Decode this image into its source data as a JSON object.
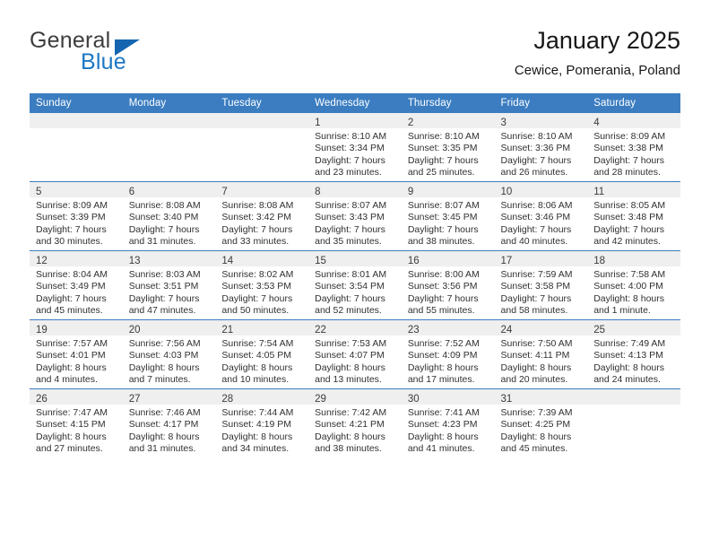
{
  "brand": {
    "name_part1": "General",
    "name_part2": "Blue",
    "triangle_icon": "triangle-icon",
    "accent_color": "#1565b0"
  },
  "header": {
    "title": "January 2025",
    "subtitle": "Cewice, Pomerania, Poland"
  },
  "theme": {
    "header_row_color": "#3b7dc0",
    "daynum_band_color": "#efefef",
    "text_color": "#303030"
  },
  "calendar": {
    "weekday_headers": [
      "Sunday",
      "Monday",
      "Tuesday",
      "Wednesday",
      "Thursday",
      "Friday",
      "Saturday"
    ],
    "weeks": [
      [
        {
          "day": "",
          "lines": []
        },
        {
          "day": "",
          "lines": []
        },
        {
          "day": "",
          "lines": []
        },
        {
          "day": "1",
          "lines": [
            "Sunrise: 8:10 AM",
            "Sunset: 3:34 PM",
            "Daylight: 7 hours",
            "and 23 minutes."
          ]
        },
        {
          "day": "2",
          "lines": [
            "Sunrise: 8:10 AM",
            "Sunset: 3:35 PM",
            "Daylight: 7 hours",
            "and 25 minutes."
          ]
        },
        {
          "day": "3",
          "lines": [
            "Sunrise: 8:10 AM",
            "Sunset: 3:36 PM",
            "Daylight: 7 hours",
            "and 26 minutes."
          ]
        },
        {
          "day": "4",
          "lines": [
            "Sunrise: 8:09 AM",
            "Sunset: 3:38 PM",
            "Daylight: 7 hours",
            "and 28 minutes."
          ]
        }
      ],
      [
        {
          "day": "5",
          "lines": [
            "Sunrise: 8:09 AM",
            "Sunset: 3:39 PM",
            "Daylight: 7 hours",
            "and 30 minutes."
          ]
        },
        {
          "day": "6",
          "lines": [
            "Sunrise: 8:08 AM",
            "Sunset: 3:40 PM",
            "Daylight: 7 hours",
            "and 31 minutes."
          ]
        },
        {
          "day": "7",
          "lines": [
            "Sunrise: 8:08 AM",
            "Sunset: 3:42 PM",
            "Daylight: 7 hours",
            "and 33 minutes."
          ]
        },
        {
          "day": "8",
          "lines": [
            "Sunrise: 8:07 AM",
            "Sunset: 3:43 PM",
            "Daylight: 7 hours",
            "and 35 minutes."
          ]
        },
        {
          "day": "9",
          "lines": [
            "Sunrise: 8:07 AM",
            "Sunset: 3:45 PM",
            "Daylight: 7 hours",
            "and 38 minutes."
          ]
        },
        {
          "day": "10",
          "lines": [
            "Sunrise: 8:06 AM",
            "Sunset: 3:46 PM",
            "Daylight: 7 hours",
            "and 40 minutes."
          ]
        },
        {
          "day": "11",
          "lines": [
            "Sunrise: 8:05 AM",
            "Sunset: 3:48 PM",
            "Daylight: 7 hours",
            "and 42 minutes."
          ]
        }
      ],
      [
        {
          "day": "12",
          "lines": [
            "Sunrise: 8:04 AM",
            "Sunset: 3:49 PM",
            "Daylight: 7 hours",
            "and 45 minutes."
          ]
        },
        {
          "day": "13",
          "lines": [
            "Sunrise: 8:03 AM",
            "Sunset: 3:51 PM",
            "Daylight: 7 hours",
            "and 47 minutes."
          ]
        },
        {
          "day": "14",
          "lines": [
            "Sunrise: 8:02 AM",
            "Sunset: 3:53 PM",
            "Daylight: 7 hours",
            "and 50 minutes."
          ]
        },
        {
          "day": "15",
          "lines": [
            "Sunrise: 8:01 AM",
            "Sunset: 3:54 PM",
            "Daylight: 7 hours",
            "and 52 minutes."
          ]
        },
        {
          "day": "16",
          "lines": [
            "Sunrise: 8:00 AM",
            "Sunset: 3:56 PM",
            "Daylight: 7 hours",
            "and 55 minutes."
          ]
        },
        {
          "day": "17",
          "lines": [
            "Sunrise: 7:59 AM",
            "Sunset: 3:58 PM",
            "Daylight: 7 hours",
            "and 58 minutes."
          ]
        },
        {
          "day": "18",
          "lines": [
            "Sunrise: 7:58 AM",
            "Sunset: 4:00 PM",
            "Daylight: 8 hours",
            "and 1 minute."
          ]
        }
      ],
      [
        {
          "day": "19",
          "lines": [
            "Sunrise: 7:57 AM",
            "Sunset: 4:01 PM",
            "Daylight: 8 hours",
            "and 4 minutes."
          ]
        },
        {
          "day": "20",
          "lines": [
            "Sunrise: 7:56 AM",
            "Sunset: 4:03 PM",
            "Daylight: 8 hours",
            "and 7 minutes."
          ]
        },
        {
          "day": "21",
          "lines": [
            "Sunrise: 7:54 AM",
            "Sunset: 4:05 PM",
            "Daylight: 8 hours",
            "and 10 minutes."
          ]
        },
        {
          "day": "22",
          "lines": [
            "Sunrise: 7:53 AM",
            "Sunset: 4:07 PM",
            "Daylight: 8 hours",
            "and 13 minutes."
          ]
        },
        {
          "day": "23",
          "lines": [
            "Sunrise: 7:52 AM",
            "Sunset: 4:09 PM",
            "Daylight: 8 hours",
            "and 17 minutes."
          ]
        },
        {
          "day": "24",
          "lines": [
            "Sunrise: 7:50 AM",
            "Sunset: 4:11 PM",
            "Daylight: 8 hours",
            "and 20 minutes."
          ]
        },
        {
          "day": "25",
          "lines": [
            "Sunrise: 7:49 AM",
            "Sunset: 4:13 PM",
            "Daylight: 8 hours",
            "and 24 minutes."
          ]
        }
      ],
      [
        {
          "day": "26",
          "lines": [
            "Sunrise: 7:47 AM",
            "Sunset: 4:15 PM",
            "Daylight: 8 hours",
            "and 27 minutes."
          ]
        },
        {
          "day": "27",
          "lines": [
            "Sunrise: 7:46 AM",
            "Sunset: 4:17 PM",
            "Daylight: 8 hours",
            "and 31 minutes."
          ]
        },
        {
          "day": "28",
          "lines": [
            "Sunrise: 7:44 AM",
            "Sunset: 4:19 PM",
            "Daylight: 8 hours",
            "and 34 minutes."
          ]
        },
        {
          "day": "29",
          "lines": [
            "Sunrise: 7:42 AM",
            "Sunset: 4:21 PM",
            "Daylight: 8 hours",
            "and 38 minutes."
          ]
        },
        {
          "day": "30",
          "lines": [
            "Sunrise: 7:41 AM",
            "Sunset: 4:23 PM",
            "Daylight: 8 hours",
            "and 41 minutes."
          ]
        },
        {
          "day": "31",
          "lines": [
            "Sunrise: 7:39 AM",
            "Sunset: 4:25 PM",
            "Daylight: 8 hours",
            "and 45 minutes."
          ]
        },
        {
          "day": "",
          "lines": []
        }
      ]
    ]
  }
}
